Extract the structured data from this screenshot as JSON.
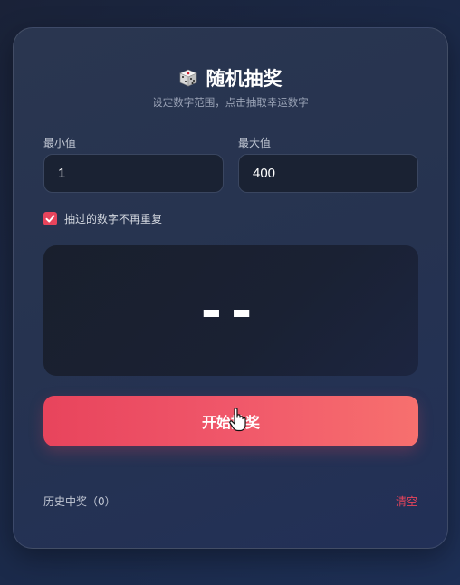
{
  "header": {
    "dice_icon": "dice-icon",
    "title": "随机抽奖",
    "subtitle": "设定数字范围，点击抽取幸运数字"
  },
  "range": {
    "min_label": "最小值",
    "min_value": "1",
    "max_label": "最大值",
    "max_value": "400"
  },
  "options": {
    "no_repeat_label": "抽过的数字不再重复",
    "no_repeat_checked": true
  },
  "result": {
    "value": "--"
  },
  "actions": {
    "start_label": "开始抽奖"
  },
  "history": {
    "label": "历史中奖（0）",
    "clear_label": "清空"
  },
  "colors": {
    "accent": "#e8445c",
    "card": "#263350",
    "input_bg": "#1a2233"
  }
}
